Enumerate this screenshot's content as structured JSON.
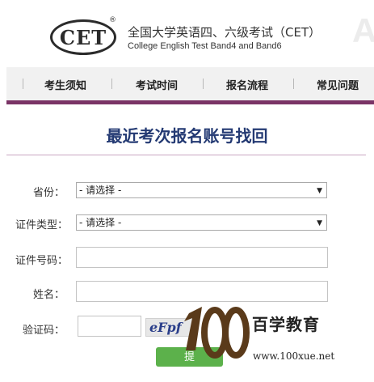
{
  "header": {
    "logo": "CET",
    "registered_mark": "®",
    "title_cn": "全国大学英语四、六级考试（CET）",
    "title_en": "College English Test Band4 and Band6",
    "ghost_letter": "A"
  },
  "nav": {
    "items": [
      {
        "label": "考生须知"
      },
      {
        "label": "考试时间"
      },
      {
        "label": "报名流程"
      },
      {
        "label": "常见问题"
      }
    ],
    "accent_color": "#7a3466"
  },
  "page": {
    "title": "最近考次报名账号找回"
  },
  "form": {
    "province": {
      "label": "省份：",
      "value": "- 请选择 -"
    },
    "id_type": {
      "label": "证件类型：",
      "value": "- 请选择 -"
    },
    "id_number": {
      "label": "证件号码：",
      "value": ""
    },
    "name": {
      "label": "姓名：",
      "value": ""
    },
    "captcha": {
      "label": "验证码：",
      "value": "",
      "image_text": "eFpf"
    },
    "submit_label": "提",
    "submit_color": "#5cb14b"
  },
  "watermark": {
    "brand": "百学教育",
    "url": "www.100xue.net"
  }
}
